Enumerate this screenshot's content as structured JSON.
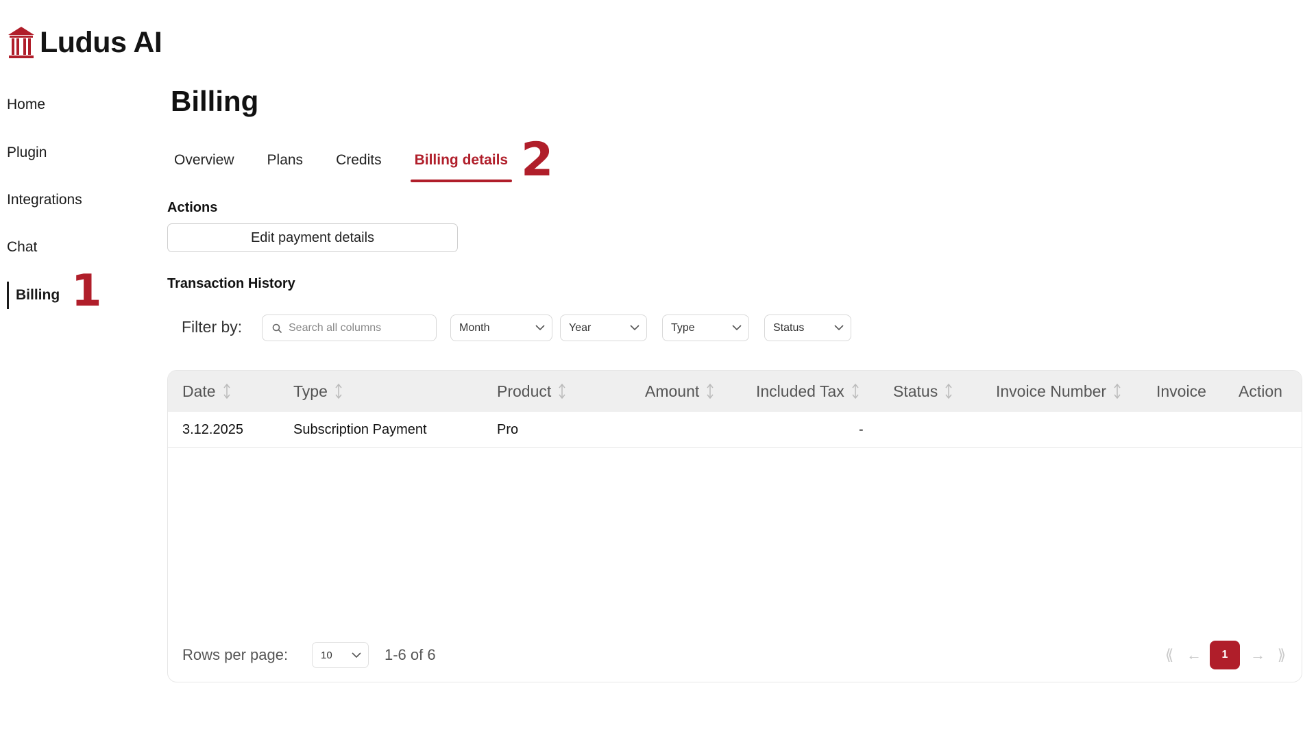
{
  "app": {
    "name": "Ludus AI"
  },
  "sidebar": {
    "items": [
      {
        "label": "Home"
      },
      {
        "label": "Plugin"
      },
      {
        "label": "Integrations"
      },
      {
        "label": "Chat"
      },
      {
        "label": "Billing",
        "active": true
      }
    ]
  },
  "annotations": {
    "marker_1": "1",
    "marker_2": "2"
  },
  "page": {
    "title": "Billing"
  },
  "tabs": [
    {
      "label": "Overview"
    },
    {
      "label": "Plans"
    },
    {
      "label": "Credits"
    },
    {
      "label": "Billing details",
      "active": true
    }
  ],
  "actions": {
    "heading": "Actions",
    "edit_payment_label": "Edit payment details"
  },
  "transactions": {
    "heading": "Transaction History",
    "filter_label": "Filter by:",
    "search_placeholder": "Search all columns",
    "filters": {
      "month": "Month",
      "year": "Year",
      "type": "Type",
      "status": "Status"
    },
    "columns": [
      "Date",
      "Type",
      "Product",
      "Amount",
      "Included Tax",
      "Status",
      "Invoice Number",
      "Invoice",
      "Action"
    ],
    "rows": [
      {
        "date": "3.12.2025",
        "type": "Subscription Payment",
        "product": "Pro",
        "amount": "",
        "tax": "-",
        "status": "",
        "invoice_number": "",
        "invoice": "",
        "action": ""
      }
    ],
    "pagination": {
      "rows_per_page_label": "Rows per page:",
      "rows_per_page_value": "10",
      "range": "1-6 of 6",
      "current_page": "1",
      "first_icon": "⟪",
      "prev_icon": "←",
      "next_icon": "→",
      "last_icon": "⟫"
    }
  },
  "colors": {
    "accent": "#b01e2a",
    "header_bg": "#efefef"
  },
  "icons": [
    "logo-icon",
    "search-icon",
    "chevron-down-icon",
    "sort-icon"
  ]
}
